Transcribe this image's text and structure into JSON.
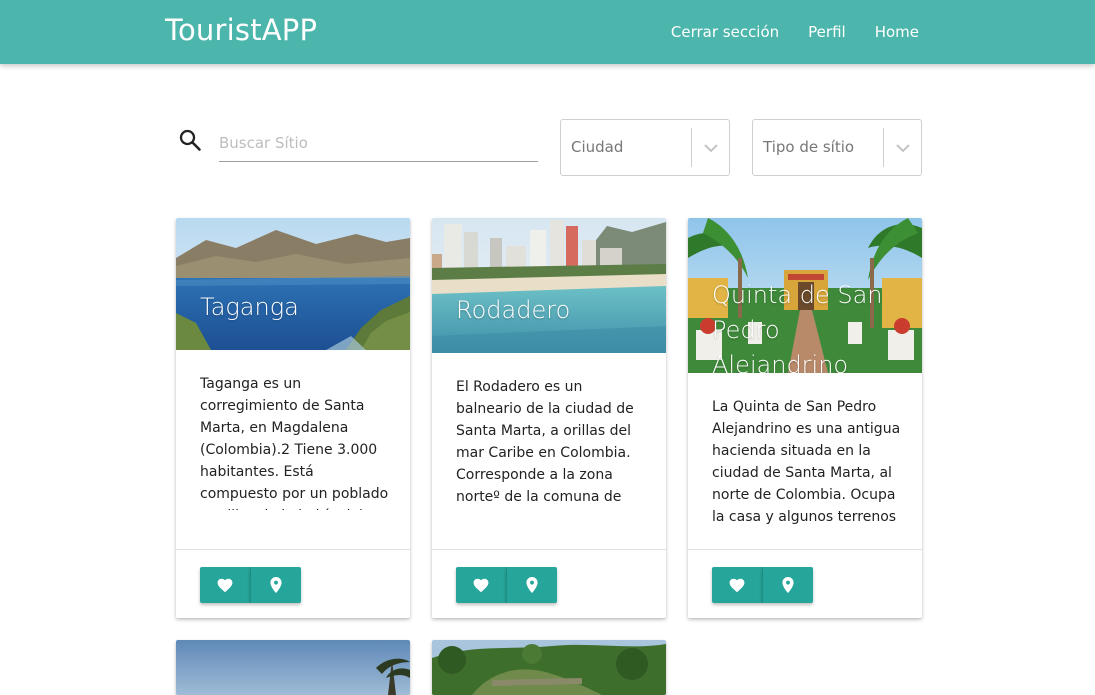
{
  "app": {
    "title": "TouristAPP"
  },
  "nav": {
    "items": [
      {
        "label": "Cerrar sección",
        "name": "nav-logout-link"
      },
      {
        "label": "Perfil",
        "name": "nav-profile-link"
      },
      {
        "label": "Home",
        "name": "nav-home-link"
      }
    ]
  },
  "search": {
    "placeholder": "Buscar Sítio",
    "value": ""
  },
  "filters": {
    "city": {
      "value": "Ciudad"
    },
    "site_type": {
      "value": "Tipo de sítio"
    }
  },
  "cards": [
    {
      "title": "Taganga",
      "text": "Taganga es un corregimiento de Santa Marta, en Magdalena (Colombia).2 Tiene 3.000 habitantes. Está compuesto por un poblado a orillas de la bahía del mismo nombre"
    },
    {
      "title": "Rodadero",
      "text": "El Rodadero es un balneario de la ciudad de Santa Marta, a orillas del mar Caribe en Colombia. Corresponde a la zona norteº de la comuna de Gaira-Rodadero y se encuentra a unos cuantos"
    },
    {
      "title": "Quinta de San Pedro Alejandrino",
      "text": "La Quinta de San Pedro Alejandrino es una antigua hacienda situada en la ciudad de Santa Marta, al norte de Colombia. Ocupa la casa y algunos terrenos de un trapiche del siglo XVII"
    }
  ],
  "icons": {
    "like": "heart-icon",
    "location": "location-pin-icon",
    "search": "search-icon",
    "dropdown": "chevron-down-icon"
  },
  "colors": {
    "navbar": "#4db6ac",
    "button": "#26a69a"
  }
}
